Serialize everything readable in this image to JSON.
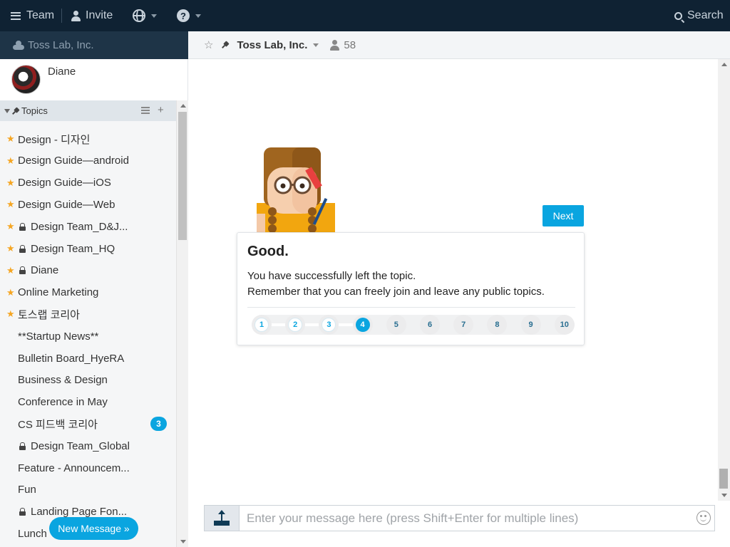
{
  "topbar": {
    "team_label": "Team",
    "invite_label": "Invite",
    "language_icon": "globe-icon",
    "help_icon": "question-icon",
    "search_label": "Search"
  },
  "sidebar": {
    "team_name": "Toss Lab, Inc.",
    "user_name": "Diane",
    "topics_header": "Topics",
    "topics": [
      {
        "label": "Design - 디자인",
        "starred": true,
        "locked": false
      },
      {
        "label": "Design Guide—android",
        "starred": true,
        "locked": false
      },
      {
        "label": "Design Guide—iOS",
        "starred": true,
        "locked": false
      },
      {
        "label": "Design Guide—Web",
        "starred": true,
        "locked": false
      },
      {
        "label": "Design Team_D&J...",
        "starred": true,
        "locked": true
      },
      {
        "label": "Design Team_HQ",
        "starred": true,
        "locked": true
      },
      {
        "label": "Diane",
        "starred": true,
        "locked": true
      },
      {
        "label": "Online Marketing",
        "starred": true,
        "locked": false
      },
      {
        "label": "토스랩 코리아",
        "starred": true,
        "locked": false
      },
      {
        "label": "**Startup News**",
        "starred": false,
        "locked": false
      },
      {
        "label": "Bulletin Board_HyeRA",
        "starred": false,
        "locked": false
      },
      {
        "label": "Business & Design",
        "starred": false,
        "locked": false
      },
      {
        "label": "Conference in May",
        "starred": false,
        "locked": false
      },
      {
        "label": "CS 피드백 코리아",
        "starred": false,
        "locked": false,
        "badge": "3"
      },
      {
        "label": "Design Team_Global",
        "starred": false,
        "locked": true
      },
      {
        "label": "Feature - Announcem...",
        "starred": false,
        "locked": false
      },
      {
        "label": "Fun",
        "starred": false,
        "locked": false
      },
      {
        "label": "Landing Page Fon...",
        "starred": false,
        "locked": true
      },
      {
        "label": "Lunch",
        "starred": false,
        "locked": false
      }
    ],
    "new_message_label": "New Message »"
  },
  "main": {
    "title": "Toss Lab, Inc.",
    "member_count": "58"
  },
  "tutorial": {
    "next_label": "Next",
    "title": "Good.",
    "line1": "You have successfully left the topic.",
    "line2": "Remember that you can freely join and leave any public topics.",
    "steps": [
      "1",
      "2",
      "3",
      "4",
      "5",
      "6",
      "7",
      "8",
      "9",
      "10"
    ],
    "current_step": 4
  },
  "composer": {
    "placeholder": "Enter your message here (press Shift+Enter for multiple lines)"
  },
  "colors": {
    "topbar": "#0f2233",
    "accent": "#0aa5e0",
    "star": "#f5a623"
  }
}
